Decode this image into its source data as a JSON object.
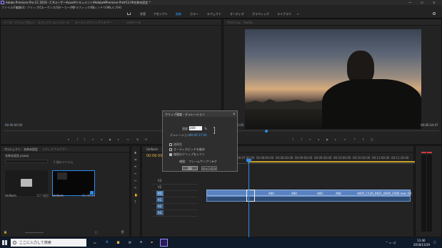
{
  "window": {
    "title": "Adobe Premiere Pro CC 2019 - C:¥ユーザー¥user¥ドキュメント¥Adobe¥Premiere Pro¥13.0¥名称未設定 *"
  },
  "menu": [
    "ファイル(F)",
    "編集(E)",
    "クリップ(C)",
    "シーケンス(S)",
    "マーカー(M)",
    "グラフィック(G)",
    "ウィンドウ(W)",
    "ヘルプ(H)"
  ],
  "workspaces": [
    "学習",
    "アセンブリ",
    "編集",
    "カラー",
    "エフェクト",
    "オーディオ",
    "グラフィック",
    "ライブラリ"
  ],
  "source_panel": {
    "tabs": [
      "ソース：(クリップなし)",
      "エフェクトコントロール",
      "オーディオクリップミキサー",
      "メタデータ"
    ],
    "timecode": "00:00:00:00"
  },
  "program_panel": {
    "tab": "プログラム：Aucka...",
    "timecode_left": "00:00:00:00",
    "timecode_right": "00:00:34:47"
  },
  "project_panel": {
    "tabs": [
      "プロジェクト：名称未設定",
      "メディアブラウザー"
    ],
    "project_file": "名称未設定.prproj",
    "item_count": "2 個のアイテム",
    "items": [
      {
        "name": "Uniform",
        "meta": "117 項目"
      },
      {
        "name": "Uniform",
        "meta": "01:38:49"
      }
    ]
  },
  "timeline": {
    "tab": "Uniform",
    "timecode": "00:06:50:00",
    "ruler": [
      "00:00:00",
      "00:07:00:00",
      "00:07:30:00",
      "00:08:00:00",
      "00:08:30:00",
      "00:09:00:00",
      "00:09:30:00",
      "00:10:00:00",
      "00:10:30:00",
      "00:11:00:00",
      "00:11:30:00"
    ],
    "tracks": [
      "V3",
      "V2",
      "V1",
      "A1",
      "A2",
      "A3"
    ],
    "clip_long_label": "A005_C126_0821_0040_2580.mov [V]",
    "clip_short_labels": [
      "A00",
      "A00",
      "A00",
      "A00"
    ]
  },
  "dialog": {
    "title": "クリップ速度・デュレーション",
    "speed_label": "速度：",
    "speed_value": "200",
    "speed_unit": "%",
    "duration_label": "デュレーション：",
    "duration_value": "00:00:17:00",
    "options": [
      "逆再生",
      "オーディオピッチを維持",
      "後続のクリップをシフト"
    ],
    "interp_label": "補間：",
    "interp_value": "フレームサンプリング",
    "ok": "OK",
    "cancel": "キャンセル"
  },
  "taskbar": {
    "search_placeholder": "ここに入力して検索",
    "time": "13:46",
    "date": "2018/12/29"
  },
  "colors": {
    "accent": "#2d8ceb",
    "video_track": "#4e7fb8",
    "audio_track": "#3b5f8a"
  }
}
